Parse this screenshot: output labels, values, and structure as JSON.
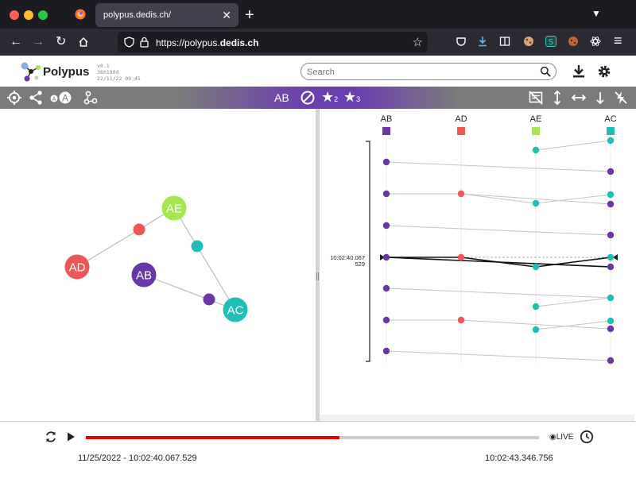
{
  "browser": {
    "tab_title": "polypus.dedis.ch/",
    "url_prefix": "https://polypus.",
    "url_domain": "dedis.ch",
    "traffic_colors": [
      "#ff5f57",
      "#febc2e",
      "#28c840"
    ]
  },
  "header": {
    "app_name": "Polypus",
    "version": "v0.1",
    "commit": "360190d",
    "build_date": "22/11/22 09:45",
    "search_placeholder": "Search",
    "icons": [
      "download-icon",
      "gear-icon"
    ]
  },
  "toolbar": {
    "left_icons": [
      "target-icon",
      "share-icon",
      "label-toggle-icon",
      "graph-nodes-icon"
    ],
    "label_toggle_small": "A",
    "label_toggle_big": "A",
    "selected_node": "AB",
    "star2_sub": "2",
    "star3_sub": "3",
    "right_icons": [
      "hide-messages-icon",
      "vertical-arrows-icon",
      "horizontal-arrows-icon",
      "down-arrow-icon",
      "flash-off-icon"
    ]
  },
  "graph": {
    "nodes": [
      {
        "id": "AE",
        "label": "AE",
        "color": "#a6e64f"
      },
      {
        "id": "AD",
        "label": "AD",
        "color": "#ef5656"
      },
      {
        "id": "AB",
        "label": "AB",
        "color": "#6a37a6"
      },
      {
        "id": "AC",
        "label": "AC",
        "color": "#1fbfb8"
      }
    ],
    "message_dots": [
      {
        "color": "#ef5656"
      },
      {
        "color": "#1fbfb8"
      },
      {
        "color": "#6a37a6"
      }
    ]
  },
  "sequence": {
    "columns": [
      {
        "label": "AB",
        "color": "#6a37a6"
      },
      {
        "label": "AD",
        "color": "#ef5656"
      },
      {
        "label": "AE",
        "color": "#a6e64f"
      },
      {
        "label": "AC",
        "color": "#1fbfb8"
      }
    ],
    "current_time": "10:02:40.067",
    "current_time_sub": "529"
  },
  "player": {
    "progress_fraction": 0.56,
    "live_label": "LIVE",
    "start_time": "11/25/2022 - 10:02:40.067.529",
    "end_time": "10:02:43.346.756"
  }
}
